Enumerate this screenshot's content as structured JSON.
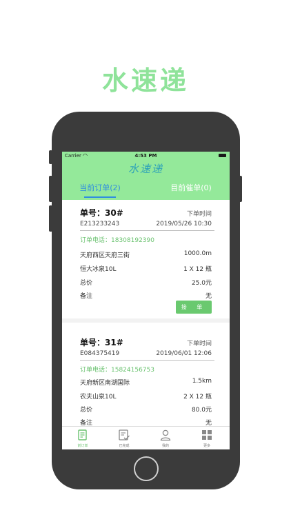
{
  "promo": {
    "title": "水速递"
  },
  "status_bar": {
    "carrier": "Carrier",
    "time": "4:53 PM"
  },
  "app": {
    "title": "水速递"
  },
  "tabs": [
    {
      "label": "当前订单(2)",
      "active": true
    },
    {
      "label": "目前催单(0)",
      "active": false
    }
  ],
  "orders": [
    {
      "order_no": "单号：30#",
      "time_label": "下单时间",
      "code": "E213233243",
      "time": "2019/05/26 10:30",
      "phone": "订单电话：18308192390",
      "address": "天府西区天府三街",
      "distance": "1000.0m",
      "product": "恒大冰泉10L",
      "quantity": "1 X 12 瓶",
      "total_label": "总价",
      "total": "25.0元",
      "note_label": "备注",
      "note": "无",
      "action": "接 单"
    },
    {
      "order_no": "单号：31#",
      "time_label": "下单时间",
      "code": "E084375419",
      "time": "2019/06/01 12:06",
      "phone": "订单电话：15824156753",
      "address": "天府新区南湖国际",
      "distance": "1.5km",
      "product": "农夫山泉10L",
      "quantity": "2 X 12 瓶",
      "total_label": "总价",
      "total": "80.0元",
      "note_label": "备注",
      "note": "无"
    }
  ],
  "tab_bar": [
    {
      "label": "前订单",
      "icon": "order-list-icon",
      "active": true
    },
    {
      "label": "已完成",
      "icon": "completed-icon",
      "active": false
    },
    {
      "label": "我的",
      "icon": "user-icon",
      "active": false
    },
    {
      "label": "更多",
      "icon": "grid-icon",
      "active": false
    }
  ],
  "colors": {
    "brand_green": "#94e99a",
    "promo_green": "#8fe39a",
    "accent_blue": "#2f8de0",
    "action_green": "#6ac96f"
  }
}
